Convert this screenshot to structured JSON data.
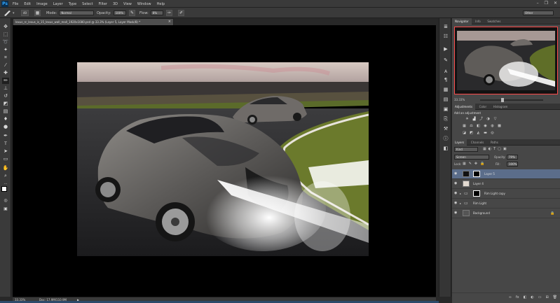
{
  "app": {
    "logo": "Ps"
  },
  "menu": [
    "File",
    "Edit",
    "Image",
    "Layer",
    "Type",
    "Select",
    "Filter",
    "3D",
    "View",
    "Window",
    "Help"
  ],
  "window_controls": [
    "–",
    "❐",
    "✕"
  ],
  "options_bar": {
    "brush_size": "40",
    "mode_label": "Mode:",
    "mode_value": "Normal",
    "opacity_label": "Opacity:",
    "opacity_value": "100%",
    "flow_label": "Flow:",
    "flow_value": "8%",
    "workspace": "Other"
  },
  "document": {
    "tab_title": "lexus_rc_lexus_is_15_lexus_wall_mall_1920x1080.psd @ 33.3% (Layer 5, Layer Mask/8) *",
    "close": "×"
  },
  "status": {
    "zoom": "33.33%",
    "doc": "Doc: 17.9M/110.9M",
    "arrow": "▶"
  },
  "panels": {
    "top_tabs": [
      "Navigator",
      "Info",
      "Swatches"
    ],
    "nav_zoom": "33.33%",
    "adj_tabs": [
      "Adjustments",
      "Color",
      "Histogram"
    ],
    "adj_title": "Add an adjustment",
    "layer_tabs": [
      "Layers",
      "Channels",
      "Paths"
    ],
    "kind_label": "Kind",
    "blend_mode": "Screen",
    "opacity_label": "Opacity:",
    "opacity_value": "79%",
    "lock_label": "Lock:",
    "fill_label": "Fill:",
    "fill_value": "100%",
    "layers": [
      {
        "name": "Layer 5",
        "selected": true
      },
      {
        "name": "Layer 4",
        "selected": false
      },
      {
        "name": "Rim Light copy",
        "selected": false
      },
      {
        "name": "Rim Light",
        "selected": false
      },
      {
        "name": "Background",
        "selected": false
      }
    ],
    "bottom_icons": [
      "∞",
      "fx",
      "◧",
      "◐",
      "▭",
      "⊞",
      "🗑"
    ]
  }
}
